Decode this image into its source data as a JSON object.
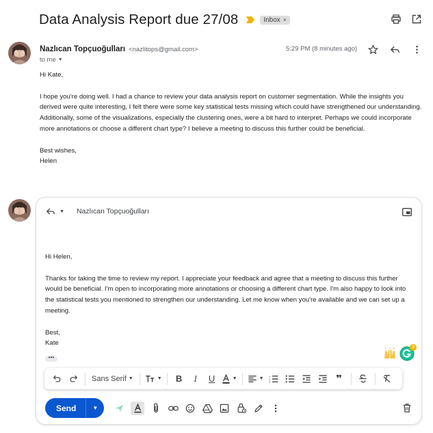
{
  "subject": {
    "title": "Data Analysis Report due 27/08",
    "label": "Inbox",
    "label_remove": "×",
    "icons": [
      "important-marker-icon",
      "print-icon",
      "open-in-new-window-icon"
    ]
  },
  "message": {
    "sender_name": "Nazlıcan Topçuoğulları",
    "sender_email": "<nazlitops@gmail.com>",
    "recipient_line": "to me",
    "time": "5:29 PM (8 minutes ago)",
    "icons": [
      "star-icon",
      "reply-icon",
      "more-vert-icon"
    ],
    "body": [
      "Hi Kate,",
      "I hope you're doing well. I had a chance to review your data analysis report on customer segmentation. While the insights you derived were quite interesting, I felt there were some key statistical tests missing which could have strengthened our understanding. Additionally, some of the visualizations, especially the clustering ones, were a bit hard to interpret. Perhaps we could incorporate more annotations or choose a different chart type? I believe a meeting to discuss this further could be beneficial.",
      "Best wishes,\nHelen"
    ]
  },
  "reply": {
    "recipient": "Nazlıcan Topçuoğulları",
    "body": [
      "Hi Helen,",
      "Thanks for taking the time to review my report. I appreciate your feedback and agree that a meeting to discuss this further would be beneficial. I'm open to incorporating more annotations or choosing a different chart type. I'm also happy to look into the statistical tests you mentioned to strengthen our understanding. Let me know when you're available and we can set up a meeting.",
      "Best,\nKate"
    ],
    "ellipsis": "•••",
    "grammarly_count": "3",
    "format_toolbar": {
      "font": "Sans Serif",
      "quote": "❞"
    },
    "send_label": "Send",
    "accent": "#0b57d0"
  }
}
